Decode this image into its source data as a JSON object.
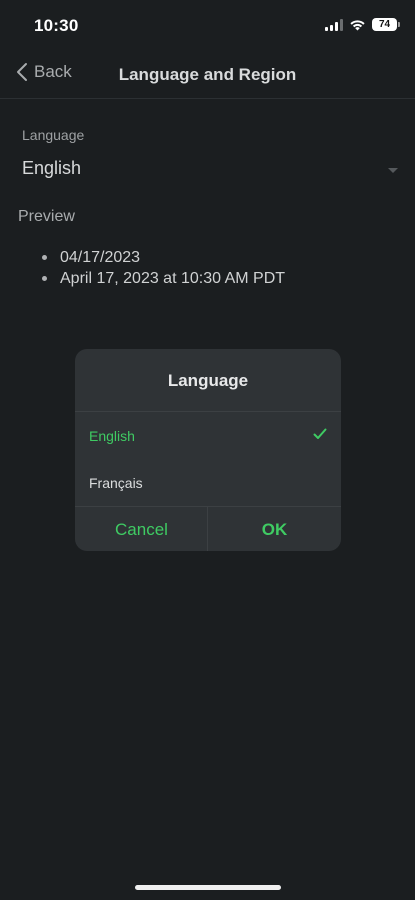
{
  "status_bar": {
    "time": "10:30",
    "battery_level": "74",
    "icons": [
      "signal-icon",
      "wifi-icon",
      "battery-icon"
    ]
  },
  "nav": {
    "back_label": "Back",
    "title": "Language and Region"
  },
  "settings": {
    "language_label": "Language",
    "language_value": "English",
    "preview_heading": "Preview",
    "preview_items": [
      "04/17/2023",
      "April 17, 2023 at 10:30 AM PDT"
    ]
  },
  "dialog": {
    "title": "Language",
    "options": [
      {
        "label": "English",
        "selected": true
      },
      {
        "label": "Français",
        "selected": false
      }
    ],
    "cancel_label": "Cancel",
    "ok_label": "OK"
  },
  "colors": {
    "background": "#1b1e20",
    "dialog_background": "#2f3336",
    "accent": "#3fcb63"
  }
}
